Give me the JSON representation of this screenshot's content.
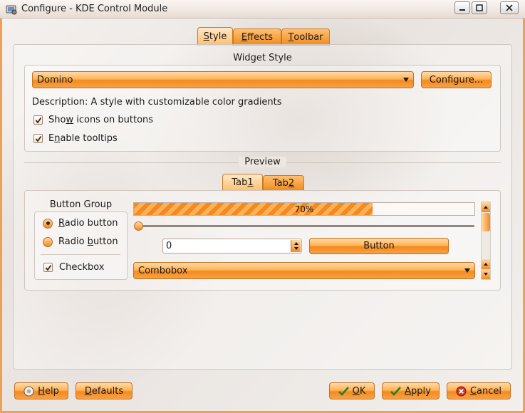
{
  "window": {
    "title": "Configure - KDE Control Module"
  },
  "tabs": [
    {
      "pre": "",
      "key": "S",
      "post": "tyle",
      "active": true
    },
    {
      "pre": "",
      "key": "E",
      "post": "ffects",
      "active": false
    },
    {
      "pre": "",
      "key": "T",
      "post": "oolbar",
      "active": false
    }
  ],
  "widget_style": {
    "group_title": "Widget Style",
    "selected_style": "Domino",
    "configure_label": "Configure...",
    "description": "Description: A style with customizable color gradients",
    "show_icons": {
      "pre": "Sho",
      "key": "w",
      "post": " icons on buttons",
      "checked": true
    },
    "enable_tooltips": {
      "pre": "E",
      "key": "n",
      "post": "able tooltips",
      "checked": true
    }
  },
  "preview": {
    "title": "Preview",
    "tabs": [
      {
        "pre": "Tab ",
        "key": "1",
        "active": true
      },
      {
        "pre": "Tab ",
        "key": "2",
        "active": false
      }
    ],
    "button_group": {
      "title": "Button Group",
      "radio1": {
        "key": "R",
        "post": "adio button",
        "checked": true
      },
      "radio2": {
        "pre": "Radio ",
        "key": "b",
        "post": "utton",
        "checked": false
      },
      "checkbox": {
        "label": "Checkbox",
        "checked": true
      }
    },
    "progress": {
      "value": 0.7,
      "text": "70%"
    },
    "slider": {
      "value": 0
    },
    "spinbox_value": "0",
    "button_label": "Button",
    "combobox_value": "Combobox"
  },
  "footer": {
    "help": {
      "key": "H",
      "post": "elp"
    },
    "defaults": {
      "key": "D",
      "post": "efaults"
    },
    "ok": {
      "key": "O",
      "post": "K"
    },
    "apply": {
      "key": "A",
      "post": "pply"
    },
    "cancel": {
      "key": "C",
      "post": "ancel"
    }
  },
  "colors": {
    "accent": "#f38a1f",
    "accent_light": "#ffd9a8",
    "frame": "#f0a050"
  },
  "icons": [
    "app-icon",
    "minimize-icon",
    "maximize-icon",
    "close-icon",
    "dropdown-arrow-icon",
    "check-icon",
    "help-icon",
    "ok-check-icon",
    "cancel-icon",
    "spin-arrows-icon",
    "scroll-arrow-icon"
  ]
}
